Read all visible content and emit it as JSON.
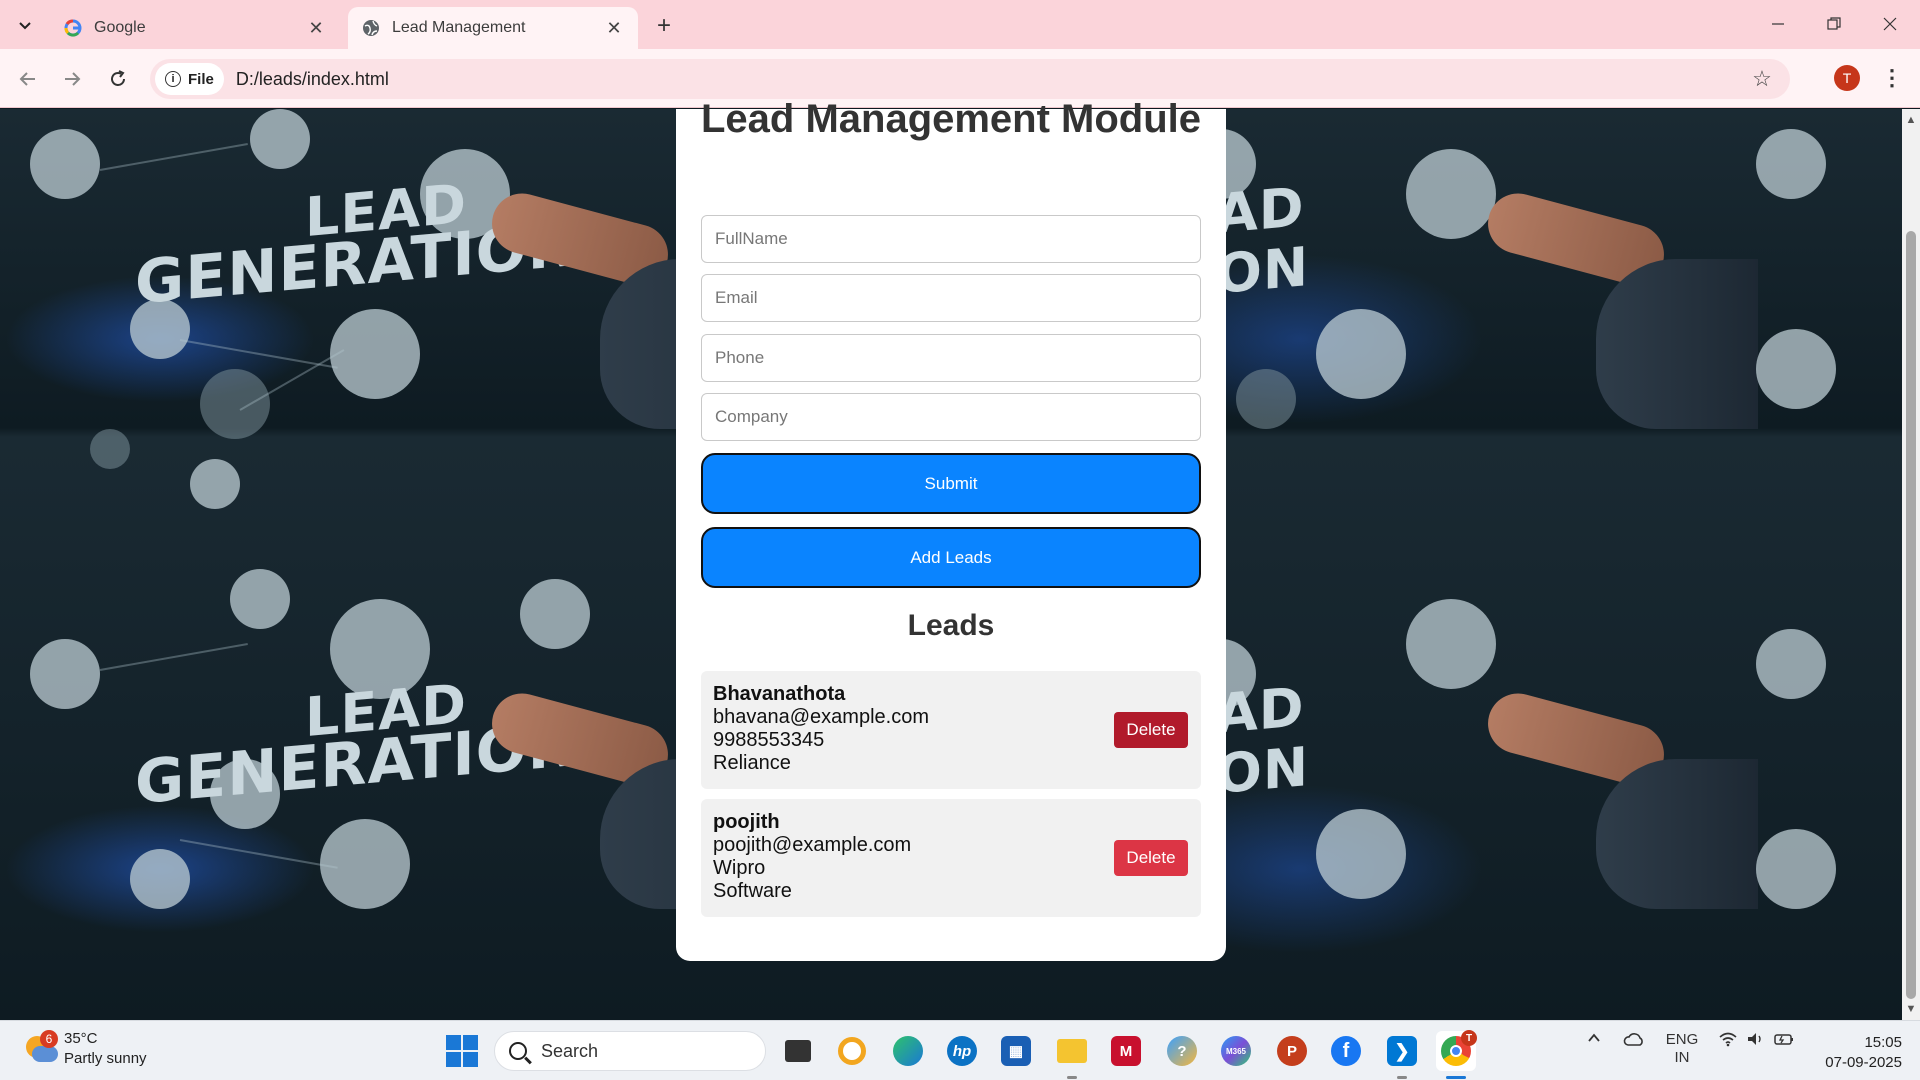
{
  "browser": {
    "tabs": [
      {
        "title": "Google",
        "active": false
      },
      {
        "title": "Lead Management",
        "active": true
      }
    ],
    "site_chip": "File",
    "url": "D:/leads/index.html",
    "profile_initial": "T"
  },
  "page": {
    "title": "Lead Management Module",
    "fields": {
      "fullname_placeholder": "FullName",
      "email_placeholder": "Email",
      "phone_placeholder": "Phone",
      "company_placeholder": "Company"
    },
    "submit_label": "Submit",
    "add_leads_label": "Add Leads",
    "leads_heading": "Leads",
    "leads": [
      {
        "name": "Bhavanathota",
        "email": "bhavana@example.com",
        "phone": "9988553345",
        "company": "Reliance",
        "delete_label": "Delete",
        "delete_color": "#b11a2b"
      },
      {
        "name": "poojith",
        "email": "poojith@example.com",
        "phone": "Wipro",
        "company": "Software",
        "delete_label": "Delete",
        "delete_color": "#dc3545"
      }
    ],
    "background_text": [
      "LEAD",
      "GENERATION"
    ],
    "primary_color": "#0a84ff"
  },
  "taskbar": {
    "weather_badge": "6",
    "temperature": "35°C",
    "weather_desc": "Partly sunny",
    "search_label": "Search",
    "language": "ENG",
    "region": "IN",
    "time": "15:05",
    "date": "07-09-2025",
    "chrome_badge": "T",
    "m365_label": "M365"
  }
}
